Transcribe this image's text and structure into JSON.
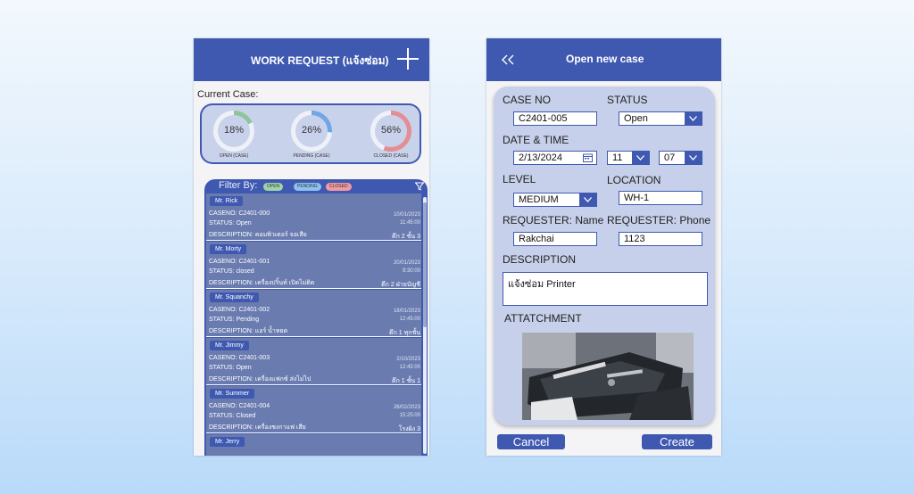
{
  "left": {
    "title": "WORK REQUEST (แจ้งซ่อม)",
    "current_case_label": "Current Case:",
    "stats": [
      {
        "value": "18%",
        "percent": 18,
        "caption": "OPEN (CASE)",
        "color": "#8fc49a"
      },
      {
        "value": "26%",
        "percent": 26,
        "caption": "PENDING (CASE)",
        "color": "#6fa7e6"
      },
      {
        "value": "56%",
        "percent": 56,
        "caption": "CLOSED (CASE)",
        "color": "#e38d94"
      }
    ],
    "filter_label": "Filter By:",
    "chips": [
      {
        "label": "OPEN",
        "color": "#9fd3a8"
      },
      {
        "label": "PENDING",
        "color": "#8ec1ef"
      },
      {
        "label": "CLOSED",
        "color": "#ef9aa0"
      }
    ],
    "cases": [
      {
        "name": "Mr. Rick",
        "caseno": "CASENO: C2401-000",
        "status": "STATUS: Open",
        "description": "DESCRIPTION: คอมพิวเตอร์ จอเสีย",
        "date": "10/01/2023",
        "time": "11:45:00",
        "location": "ตึก 2 ชั้น 3"
      },
      {
        "name": "Mr. Morty",
        "caseno": "CASENO: C2401-001",
        "status": "STATUS: closed",
        "description": "DESCRIPTION: เครื่องปริ้นท์ เปิดไม่ติด",
        "date": "20/01/2023",
        "time": "9:30:00",
        "location": "ตึก 2 ฝ่ายบัญชี"
      },
      {
        "name": "Mr. Squanchy",
        "caseno": "CASENO: C2401-002",
        "status": "STATUS: Pending",
        "description": "DESCRIPTION: แอร์ น้ำหยด",
        "date": "18/01/2023",
        "time": "12:45:00",
        "location": "ตึก 1 ทุกชั้น"
      },
      {
        "name": "Mr. Jimmy",
        "caseno": "CASENO: C2401-003",
        "status": "STATUS: Open",
        "description": "DESCRIPTION: เครื่องแฟกซ์ ส่งไม่ไป",
        "date": "2/10/2023",
        "time": "12:45:00",
        "location": "ตึก 1 ชั้น 1"
      },
      {
        "name": "Mr. Summer",
        "caseno": "CASENO: C2401-004",
        "status": "STATUS: Closed",
        "description": "DESCRIPTION: เครื่องชงกาแฟ เสีย",
        "date": "26/02/2023",
        "time": "15:25:00",
        "location": "โรงผิง 3"
      },
      {
        "name": "Mr. Jerry",
        "caseno": "",
        "status": "",
        "description": "",
        "date": "",
        "time": "",
        "location": ""
      }
    ]
  },
  "right": {
    "title": "Open new case",
    "labels": {
      "case_no": "CASE NO",
      "status": "STATUS",
      "date_time": "DATE & TIME",
      "level": "LEVEL",
      "location": "LOCATION",
      "requester_name": "REQUESTER: Name",
      "requester_phone": "REQUESTER: Phone",
      "description": "DESCRIPTION",
      "attachment": "ATTATCHMENT"
    },
    "values": {
      "case_no": "C2401-005",
      "status": "Open",
      "date": "2/13/2024",
      "hour": "11",
      "minute": "07",
      "level": "MEDIUM",
      "location": "WH-1",
      "requester_name": "Rakchai",
      "requester_phone": "1123",
      "description": "แจ้งซ่อม Printer"
    },
    "cancel_label": "Cancel",
    "create_label": "Create"
  }
}
